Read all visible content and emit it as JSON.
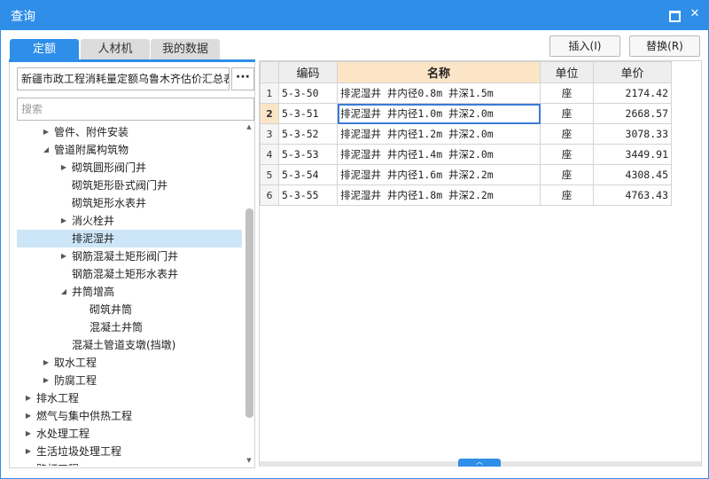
{
  "window": {
    "title": "查询",
    "maximize_icon": "maximize-icon",
    "close_icon": "close-icon",
    "close_glyph": "✕"
  },
  "tabs": [
    {
      "label": "定额",
      "active": true
    },
    {
      "label": "人材机",
      "active": false
    },
    {
      "label": "我的数据",
      "active": false
    }
  ],
  "actions": {
    "insert_label": "插入(I)",
    "replace_label": "替换(R)"
  },
  "quota_db": {
    "value": "新疆市政工程消耗量定额乌鲁木齐估价汇总表",
    "more_label": "···"
  },
  "search": {
    "placeholder": "搜索"
  },
  "tree": [
    {
      "label": "管件、附件安装",
      "level": 1,
      "arrow": "▶"
    },
    {
      "label": "管道附属构筑物",
      "level": 1,
      "arrow": "◢"
    },
    {
      "label": "砌筑圆形阀门井",
      "level": 2,
      "arrow": "▶"
    },
    {
      "label": "砌筑矩形卧式阀门井",
      "level": 2,
      "arrow": ""
    },
    {
      "label": "砌筑矩形水表井",
      "level": 2,
      "arrow": ""
    },
    {
      "label": "消火栓井",
      "level": 2,
      "arrow": "▶"
    },
    {
      "label": "排泥湿井",
      "level": 2,
      "arrow": "",
      "selected": true
    },
    {
      "label": "钢筋混凝土矩形阀门井",
      "level": 2,
      "arrow": "▶"
    },
    {
      "label": "钢筋混凝土矩形水表井",
      "level": 2,
      "arrow": ""
    },
    {
      "label": "井筒增高",
      "level": 2,
      "arrow": "◢"
    },
    {
      "label": "砌筑井筒",
      "level": 3,
      "arrow": ""
    },
    {
      "label": "混凝土井筒",
      "level": 3,
      "arrow": ""
    },
    {
      "label": "混凝土管道支墩(挡墩)",
      "level": 2,
      "arrow": ""
    },
    {
      "label": "取水工程",
      "level": 1,
      "arrow": "▶"
    },
    {
      "label": "防腐工程",
      "level": 1,
      "arrow": "▶"
    },
    {
      "label": "排水工程",
      "level": 0,
      "arrow": "▶"
    },
    {
      "label": "燃气与集中供热工程",
      "level": 0,
      "arrow": "▶"
    },
    {
      "label": "水处理工程",
      "level": 0,
      "arrow": "▶"
    },
    {
      "label": "生活垃圾处理工程",
      "level": 0,
      "arrow": "▶"
    },
    {
      "label": "路灯工程",
      "level": 0,
      "arrow": "▶"
    }
  ],
  "grid": {
    "headers": {
      "code": "编码",
      "name": "名称",
      "unit": "单位",
      "price": "单价"
    },
    "rows": [
      {
        "n": "1",
        "code": "5-3-50",
        "name": "排泥湿井 井内径0.8m 井深1.5m",
        "unit": "座",
        "price": "2174.42"
      },
      {
        "n": "2",
        "code": "5-3-51",
        "name": "排泥湿井 井内径1.0m 井深2.0m",
        "unit": "座",
        "price": "2668.57",
        "active": true
      },
      {
        "n": "3",
        "code": "5-3-52",
        "name": "排泥湿井 井内径1.2m 井深2.0m",
        "unit": "座",
        "price": "3078.33"
      },
      {
        "n": "4",
        "code": "5-3-53",
        "name": "排泥湿井 井内径1.4m 井深2.0m",
        "unit": "座",
        "price": "3449.91"
      },
      {
        "n": "5",
        "code": "5-3-54",
        "name": "排泥湿井 井内径1.6m 井深2.2m",
        "unit": "座",
        "price": "4308.45"
      },
      {
        "n": "6",
        "code": "5-3-55",
        "name": "排泥湿井 井内径1.8m 井深2.2m",
        "unit": "座",
        "price": "4763.43"
      }
    ]
  },
  "colors": {
    "accent": "#2e8ee8",
    "selection": "#cde6f7",
    "active_header": "#fce5c6"
  }
}
